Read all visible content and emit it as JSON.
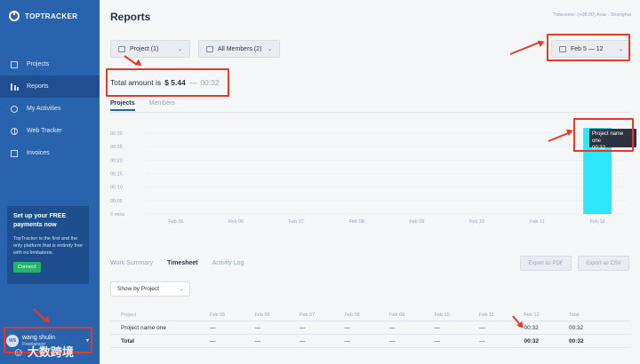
{
  "app": {
    "brand": "TOPTRACKER"
  },
  "sidebar": {
    "items": [
      {
        "label": "Projects",
        "icon": "home-icon"
      },
      {
        "label": "Reports",
        "icon": "bar-chart-icon",
        "active": true
      },
      {
        "label": "My Activities",
        "icon": "clock-icon"
      },
      {
        "label": "Web Tracker",
        "icon": "globe-icon"
      },
      {
        "label": "Invoices",
        "icon": "document-icon"
      }
    ],
    "promo": {
      "title": "Set up your FREE payments now",
      "text": "TopTracker is the first and the only platform that is entirely free with no limitations.",
      "button": "Connect"
    },
    "user": {
      "initials": "WS",
      "name": "wang shulin",
      "role": "Freelancer"
    }
  },
  "header": {
    "title": "Reports",
    "timezone": "Timezone: (+08:00) Asia - Shanghai"
  },
  "filters": {
    "project": "Project (1)",
    "members": "All Members (2)",
    "date_range": "Feb 5 — 12"
  },
  "summary": {
    "label": "Total amount is",
    "amount": "$ 5.44",
    "dash": "—",
    "time": "00:32"
  },
  "tabs_top": [
    "Projects",
    "Members"
  ],
  "chart_data": {
    "type": "bar",
    "categories": [
      "Feb 05",
      "Feb 06",
      "Feb 07",
      "Feb 08",
      "Feb 09",
      "Feb 10",
      "Feb 11",
      "Feb 12"
    ],
    "y_tick_labels": [
      "00:30",
      "00:25",
      "00:20",
      "00:15",
      "00:10",
      "00:05",
      "0 mins"
    ],
    "ylim": [
      0,
      32
    ],
    "series": [
      {
        "name": "Project name one",
        "values": [
          0,
          0,
          0,
          0,
          0,
          0,
          0,
          32
        ]
      }
    ],
    "bar_color": "#2ee6f7",
    "tooltip": {
      "title": "Project name one",
      "value": "00:32"
    }
  },
  "tabs_bottom": [
    "Work Summary",
    "Timesheet",
    "Activity Log"
  ],
  "exports": {
    "pdf": "Export as PDF",
    "csv": "Export as CSV"
  },
  "show_by": "Show by Project",
  "table": {
    "headers": [
      "Project",
      "Feb 05",
      "Feb 06",
      "Feb 07",
      "Feb 08",
      "Feb 09",
      "Feb 10",
      "Feb 11",
      "Feb 12",
      "Total"
    ],
    "rows": [
      [
        "Project name one",
        "—",
        "—",
        "—",
        "—",
        "—",
        "—",
        "—",
        "00:32",
        "00:32"
      ],
      [
        "Total",
        "—",
        "—",
        "—",
        "—",
        "—",
        "—",
        "—",
        "00:32",
        "00:32"
      ]
    ]
  },
  "watermark": "☺ 大数跨境",
  "colors": {
    "sidebar": "#2a63ad",
    "accent": "#2ee6f7",
    "annotation": "#e23b2b",
    "connect": "#27b36b"
  }
}
